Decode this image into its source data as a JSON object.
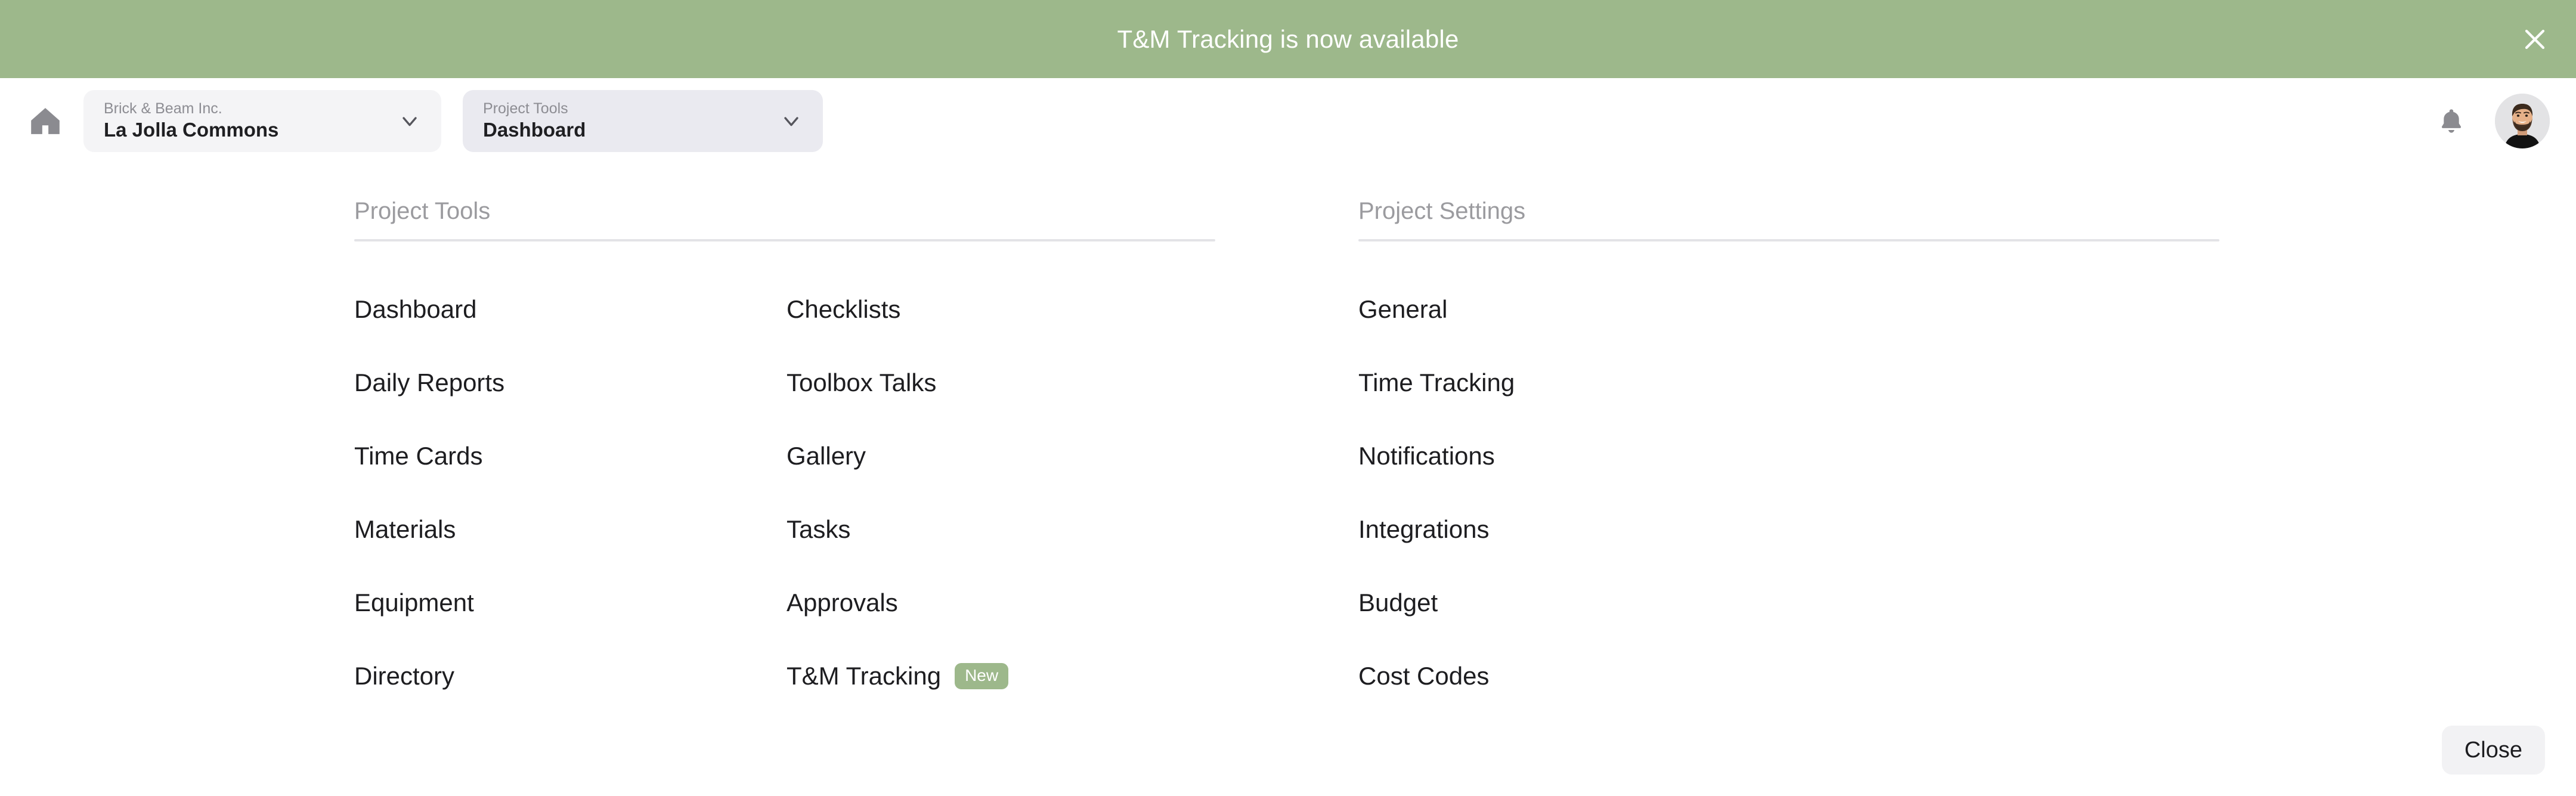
{
  "banner": {
    "message": "T&M Tracking is now available",
    "close_icon": "close-icon",
    "background_color": "#9db88b",
    "text_color": "#ffffff"
  },
  "navbar": {
    "home_icon": "home-icon",
    "org_select": {
      "label": "Brick & Beam Inc.",
      "value": "La Jolla Commons",
      "chevron_icon": "chevron-down-icon"
    },
    "tool_select": {
      "label": "Project Tools",
      "value": "Dashboard",
      "chevron_icon": "chevron-down-icon"
    },
    "notifications_icon": "bell-icon",
    "avatar": "user-avatar"
  },
  "menu": {
    "groups": [
      {
        "title": "Project Tools",
        "column_one": [
          {
            "label": "Dashboard"
          },
          {
            "label": "Daily Reports"
          },
          {
            "label": "Time Cards"
          },
          {
            "label": "Materials"
          },
          {
            "label": "Equipment"
          },
          {
            "label": "Directory"
          }
        ],
        "column_two": [
          {
            "label": "Checklists"
          },
          {
            "label": "Toolbox Talks"
          },
          {
            "label": "Gallery"
          },
          {
            "label": "Tasks"
          },
          {
            "label": "Approvals"
          },
          {
            "label": "T&M Tracking",
            "badge": "New"
          }
        ]
      },
      {
        "title": "Project Settings",
        "column_one": [
          {
            "label": "General"
          },
          {
            "label": "Time Tracking"
          },
          {
            "label": "Notifications"
          },
          {
            "label": "Integrations"
          },
          {
            "label": "Budget"
          },
          {
            "label": "Cost Codes"
          }
        ],
        "column_two": []
      }
    ]
  },
  "footer": {
    "close_label": "Close"
  },
  "colors": {
    "accent_green": "#9db88b",
    "text_primary": "#1d1d20",
    "text_muted": "#9b9b9f",
    "surface_light": "#f4f4f6",
    "surface_active": "#eaeaf0",
    "divider": "#e3e3e7"
  }
}
